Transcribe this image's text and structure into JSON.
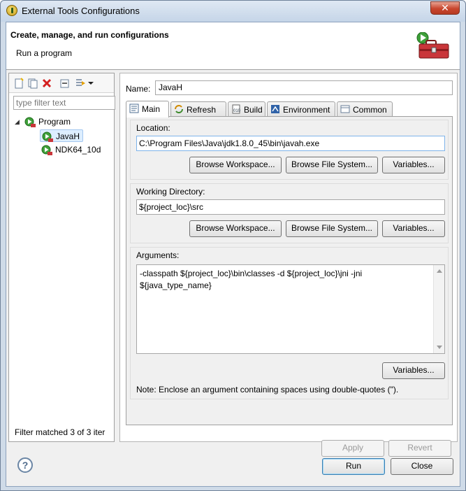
{
  "window": {
    "title": "External Tools Configurations",
    "close_glyph": "✕"
  },
  "header": {
    "title": "Create, manage, and run configurations",
    "subtitle": "Run a program"
  },
  "left": {
    "filter_placeholder": "type filter text",
    "tree": [
      {
        "label": "Program",
        "expanded": true
      },
      {
        "label": "JavaH",
        "selected": true
      },
      {
        "label": "NDK64_10d"
      }
    ],
    "status": "Filter matched 3 of 3 iter"
  },
  "config": {
    "name_label": "Name:",
    "name_value": "JavaH",
    "tabs": [
      "Main",
      "Refresh",
      "Build",
      "Environment",
      "Common"
    ],
    "active_tab": "Main",
    "location": {
      "label": "Location:",
      "value": "C:\\Program Files\\Java\\jdk1.8.0_45\\bin\\javah.exe",
      "browse_workspace": "Browse Workspace...",
      "browse_fs": "Browse File System...",
      "variables": "Variables..."
    },
    "workdir": {
      "label": "Working Directory:",
      "value": "${project_loc}\\src",
      "browse_workspace": "Browse Workspace...",
      "browse_fs": "Browse File System...",
      "variables": "Variables..."
    },
    "arguments": {
      "label": "Arguments:",
      "line1": "-classpath ${project_loc}\\bin\\classes -d ${project_loc}\\jni -jni",
      "line2": "${java_type_name}",
      "variables": "Variables...",
      "note": "Note: Enclose an argument containing spaces using double-quotes (\")."
    },
    "apply": "Apply",
    "revert": "Revert"
  },
  "footer": {
    "help_glyph": "?",
    "run": "Run",
    "close": "Close"
  },
  "colors": {
    "accent": "#3c7fb1",
    "titlebar": "#c5d5e8",
    "close": "#c8462e"
  }
}
